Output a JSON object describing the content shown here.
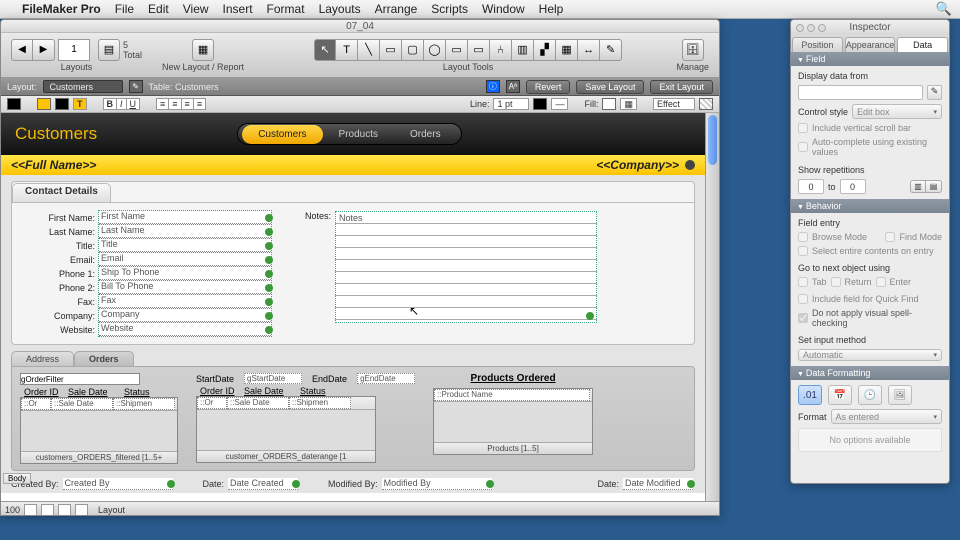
{
  "menubar": {
    "app": "FileMaker Pro",
    "items": [
      "File",
      "Edit",
      "View",
      "Insert",
      "Format",
      "Layouts",
      "Arrange",
      "Scripts",
      "Window",
      "Help"
    ]
  },
  "window": {
    "title": "07_04"
  },
  "toolbar1": {
    "page": "1",
    "total_lbl": "Total",
    "total": "5",
    "layouts": "Layouts",
    "newlayout": "New Layout / Report",
    "layouttools": "Layout Tools",
    "manage": "Manage"
  },
  "bar2": {
    "layout_lbl": "Layout:",
    "layout_val": "Customers",
    "table_lbl": "Table: Customers",
    "revert": "Revert",
    "save": "Save Layout",
    "exit": "Exit Layout"
  },
  "bar3": {
    "line_lbl": "Line:",
    "line_val": "1 pt",
    "fill_lbl": "Fill:",
    "effect": "Effect"
  },
  "layout": {
    "title": "Customers",
    "tabs": {
      "customers": "Customers",
      "products": "Products",
      "orders": "Orders"
    },
    "fullname": "<<Full Name>>",
    "company": "<<Company>>",
    "contact_tab": "Contact Details",
    "fields": {
      "firstname_l": "First Name:",
      "firstname_v": "First Name",
      "lastname_l": "Last Name:",
      "lastname_v": "Last Name",
      "title_l": "Title:",
      "title_v": "Title",
      "email_l": "Email:",
      "email_v": "Email",
      "phone1_l": "Phone 1:",
      "phone1_v": "Ship To Phone",
      "phone2_l": "Phone 2:",
      "phone2_v": "Bill To Phone",
      "fax_l": "Fax:",
      "fax_v": "Fax",
      "company_l": "Company:",
      "company_v": "Company",
      "website_l": "Website:",
      "website_v": "Website",
      "notes_l": "Notes:",
      "notes_v": "Notes"
    },
    "subtabs": {
      "address": "Address",
      "orders": "Orders"
    },
    "portal1": {
      "filter": "gOrderFilter",
      "h1": "Order ID",
      "h2": "Sale Date",
      "h3": "Status",
      "c1": "::Or",
      "c2": "::Sale Date",
      "c3": "::Shipmen",
      "foot": "customers_ORDERS_filtered [1..5+"
    },
    "portal2": {
      "start_l": "StartDate",
      "start_v": "gStartDate",
      "end_l": "EndDate",
      "end_v": "gEndDate",
      "h1": "Order ID",
      "h2": "Sale Date",
      "h3": "Status",
      "c1": "::Or",
      "c2": "::Sale Date",
      "c3": "::Shipmen",
      "foot": "customer_ORDERS_daterange [1"
    },
    "portal3": {
      "title": "Products Ordered",
      "c1": "::Product Name",
      "foot": "Products [1..5]"
    },
    "footer": {
      "createdby_l": "Created By:",
      "createdby_v": "Created By",
      "date1_l": "Date:",
      "date1_v": "Date Created",
      "modby_l": "Modified By:",
      "modby_v": "Modified By",
      "date2_l": "Date:",
      "date2_v": "Date Modified"
    },
    "part": "Body"
  },
  "status": {
    "zoom": "100",
    "mode": "Layout"
  },
  "inspector": {
    "title": "Inspector",
    "tabs": {
      "position": "Position",
      "appearance": "Appearance",
      "data": "Data"
    },
    "sec_field": "Field",
    "display_from": "Display data from",
    "ctrl_style_l": "Control style",
    "ctrl_style_v": "Edit box",
    "chk_scroll": "Include vertical scroll bar",
    "chk_auto": "Auto-complete using existing values",
    "rep_l": "Show repetitions",
    "rep_to": "to",
    "rep_a": "0",
    "rep_b": "0",
    "sec_behavior": "Behavior",
    "fieldentry": "Field entry",
    "browse": "Browse Mode",
    "find": "Find Mode",
    "selentire": "Select entire contents on entry",
    "goto": "Go to next object using",
    "tab": "Tab",
    "return": "Return",
    "enter": "Enter",
    "quickfind": "Include field for Quick Find",
    "spell": "Do not apply visual spell-checking",
    "input_l": "Set input method",
    "input_v": "Automatic",
    "sec_fmt": "Data Formatting",
    "fmt_l": "Format",
    "fmt_v": "As entered",
    "noopts": "No options available"
  }
}
